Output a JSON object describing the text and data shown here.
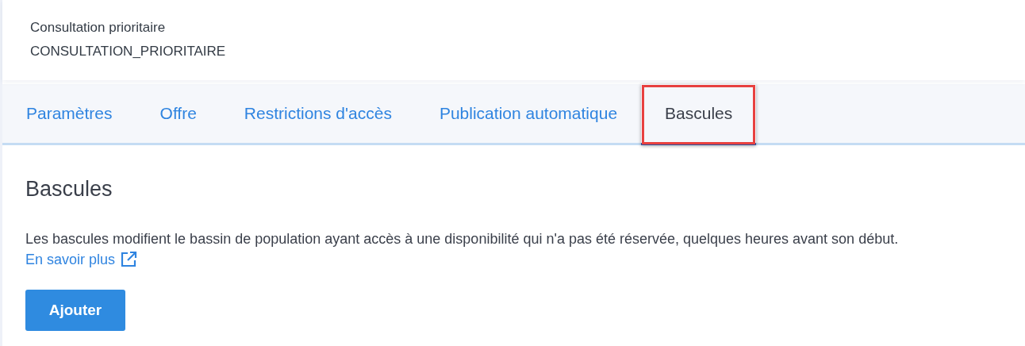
{
  "header": {
    "title": "Consultation prioritaire",
    "code": "CONSULTATION_PRIORITAIRE"
  },
  "tabs": [
    {
      "label": "Paramètres",
      "selected": false,
      "highlighted": false
    },
    {
      "label": "Offre",
      "selected": false,
      "highlighted": false
    },
    {
      "label": "Restrictions d'accès",
      "selected": false,
      "highlighted": false
    },
    {
      "label": "Publication automatique",
      "selected": false,
      "highlighted": false
    },
    {
      "label": "Bascules",
      "selected": true,
      "highlighted": true
    }
  ],
  "section": {
    "title": "Bascules",
    "description": "Les bascules modifient le bassin de population ayant accès à une disponibilité qui n'a pas été réservée, quelques heures avant son début.",
    "link": "En savoir plus",
    "button": "Ajouter"
  }
}
